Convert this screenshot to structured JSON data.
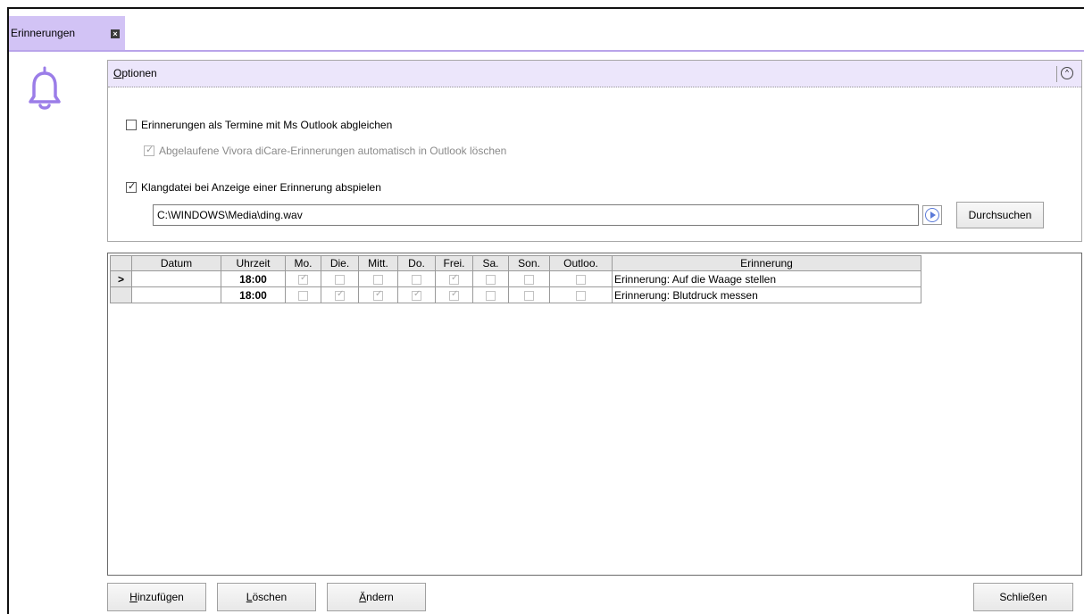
{
  "tab": {
    "label": "Erinnerungen",
    "close_glyph": "×"
  },
  "options": {
    "header_prefix": "O",
    "header_rest": "ptionen",
    "collapse_glyph": "^",
    "outlook_sync": {
      "label": "Erinnerungen als Termine mit Ms Outlook abgleichen",
      "checked": false
    },
    "auto_delete": {
      "label": "Abgelaufene Vivora diCare-Erinnerungen automatisch in Outlook löschen",
      "checked": true,
      "disabled": true
    },
    "play_sound": {
      "label": "Klangdatei bei Anzeige einer Erinnerung abspielen",
      "checked": true
    },
    "sound_path": "C:\\WINDOWS\\Media\\ding.wav",
    "browse_label": "Durchsuchen"
  },
  "grid": {
    "columns": [
      "Datum",
      "Uhrzeit",
      "Mo.",
      "Die.",
      "Mitt.",
      "Do.",
      "Frei.",
      "Sa.",
      "Son.",
      "Outloo.",
      "Erinnerung"
    ],
    "rows": [
      {
        "selector": ">",
        "datum": "",
        "uhrzeit": "18:00",
        "days": [
          true,
          false,
          false,
          false,
          true,
          false,
          false
        ],
        "outlook": false,
        "erinnerung": "Erinnerung: Auf die Waage stellen"
      },
      {
        "selector": "",
        "datum": "",
        "uhrzeit": "18:00",
        "days": [
          false,
          true,
          true,
          true,
          true,
          false,
          false
        ],
        "outlook": false,
        "erinnerung": "Erinnerung: Blutdruck messen"
      }
    ]
  },
  "buttons": {
    "add_prefix": "H",
    "add_rest": "inzufügen",
    "delete_prefix": "L",
    "delete_rest": "öschen",
    "edit_prefix": "Ä",
    "edit_rest": "ndern",
    "close_label": "Schließen"
  },
  "colors": {
    "accent": "#d2c3f5",
    "accent_line": "#b9a4ea",
    "bell": "#9b7de8"
  }
}
